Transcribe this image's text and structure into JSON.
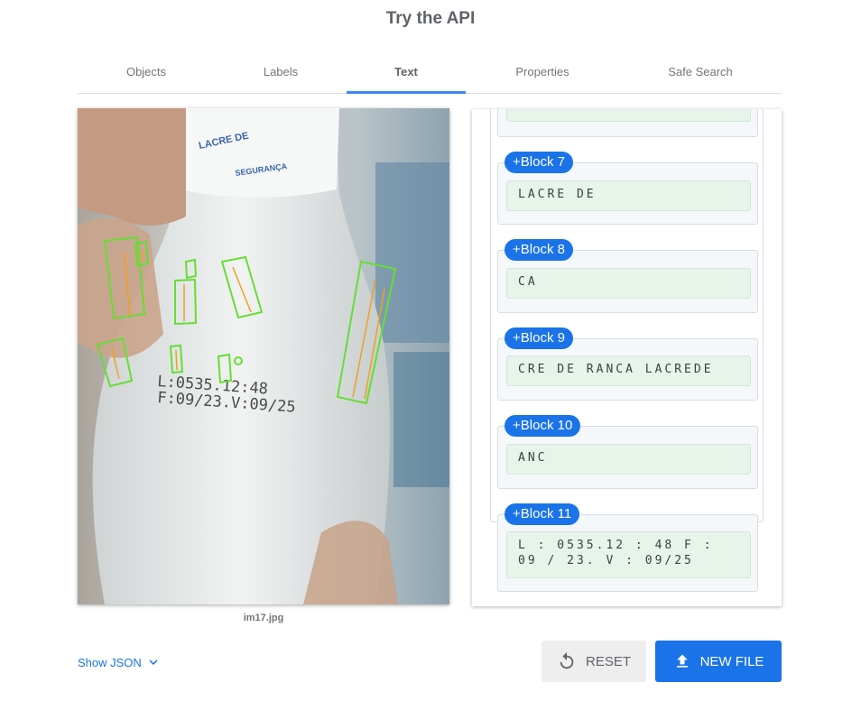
{
  "title": "Try the API",
  "tabs": [
    {
      "label": "Objects"
    },
    {
      "label": "Labels"
    },
    {
      "label": "Text"
    },
    {
      "label": "Properties"
    },
    {
      "label": "Safe Search"
    }
  ],
  "active_tab": "Text",
  "image": {
    "caption": "im17.jpg",
    "photo_text": [
      "LACRE DE",
      "SEGURANÇA",
      "L:0535.12:48",
      "F:09/23.V:09/25"
    ]
  },
  "blocks": [
    {
      "label": "+Block 7",
      "text": "LACRE DE"
    },
    {
      "label": "+Block 8",
      "text": "CA"
    },
    {
      "label": "+Block 9",
      "text": "CRE DE RANCA LACREDE"
    },
    {
      "label": "+Block 10",
      "text": "ANC"
    },
    {
      "label": "+Block 11",
      "text": "L : 0535.12 : 48 F : 09 / 23. V : 09/25"
    }
  ],
  "footer": {
    "show_json": "Show JSON",
    "reset": "RESET",
    "new_file": "NEW FILE"
  },
  "colors": {
    "accent": "#1a73e8",
    "tab_indicator": "#4285f4",
    "box_outer": "#66dd33",
    "box_inner": "#f0a020",
    "word_bg": "#e6f4ea"
  }
}
